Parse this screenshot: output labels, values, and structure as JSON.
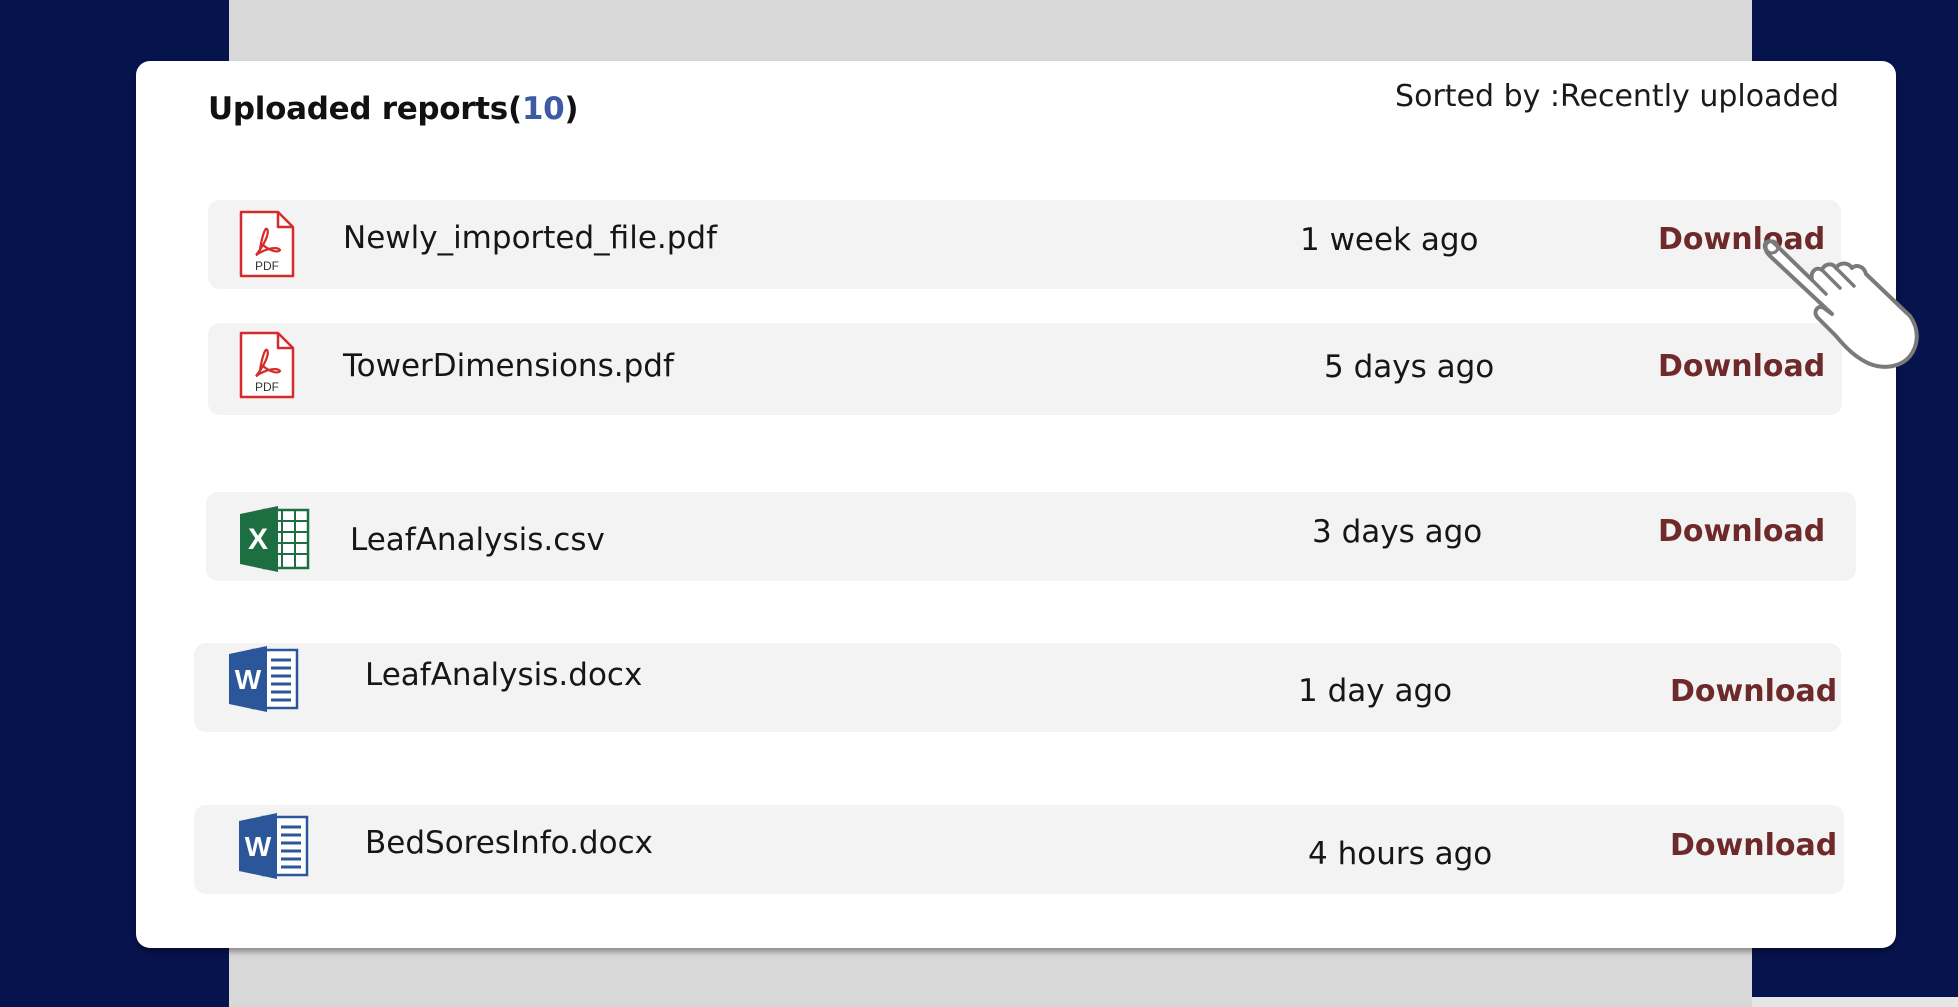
{
  "panel": {
    "title": "Uploaded reports(",
    "count": "10",
    "title_close": ")",
    "sort_label": "Sorted by :Recently uploaded"
  },
  "files": [
    {
      "name": "Newly_imported_file.pdf",
      "time": "1 week ago",
      "action": "Download",
      "type": "pdf",
      "icon_label": "PDF"
    },
    {
      "name": "TowerDimensions.pdf",
      "time": "5 days ago",
      "action": "Download",
      "type": "pdf",
      "icon_label": "PDF"
    },
    {
      "name": "LeafAnalysis.csv",
      "time": "3 days ago",
      "action": "Download",
      "type": "excel",
      "icon_label": "X"
    },
    {
      "name": "LeafAnalysis.docx",
      "time": "1 day ago",
      "action": "Download",
      "type": "word",
      "icon_label": "W"
    },
    {
      "name": "BedSoresInfo.docx",
      "time": "4 hours ago",
      "action": "Download",
      "type": "word",
      "icon_label": "W"
    }
  ],
  "colors": {
    "background_navy": "#07134c",
    "background_gray": "#d8d8d8",
    "count_blue": "#3d5aa6",
    "download_maroon": "#6e2a2a",
    "pdf_red": "#d62b2b",
    "excel_green": "#1d6f42",
    "word_blue": "#2b579a"
  },
  "icons": {
    "pdf": "pdf-file-icon",
    "excel": "excel-file-icon",
    "word": "word-file-icon",
    "cursor": "hand-pointer-cursor-icon"
  }
}
